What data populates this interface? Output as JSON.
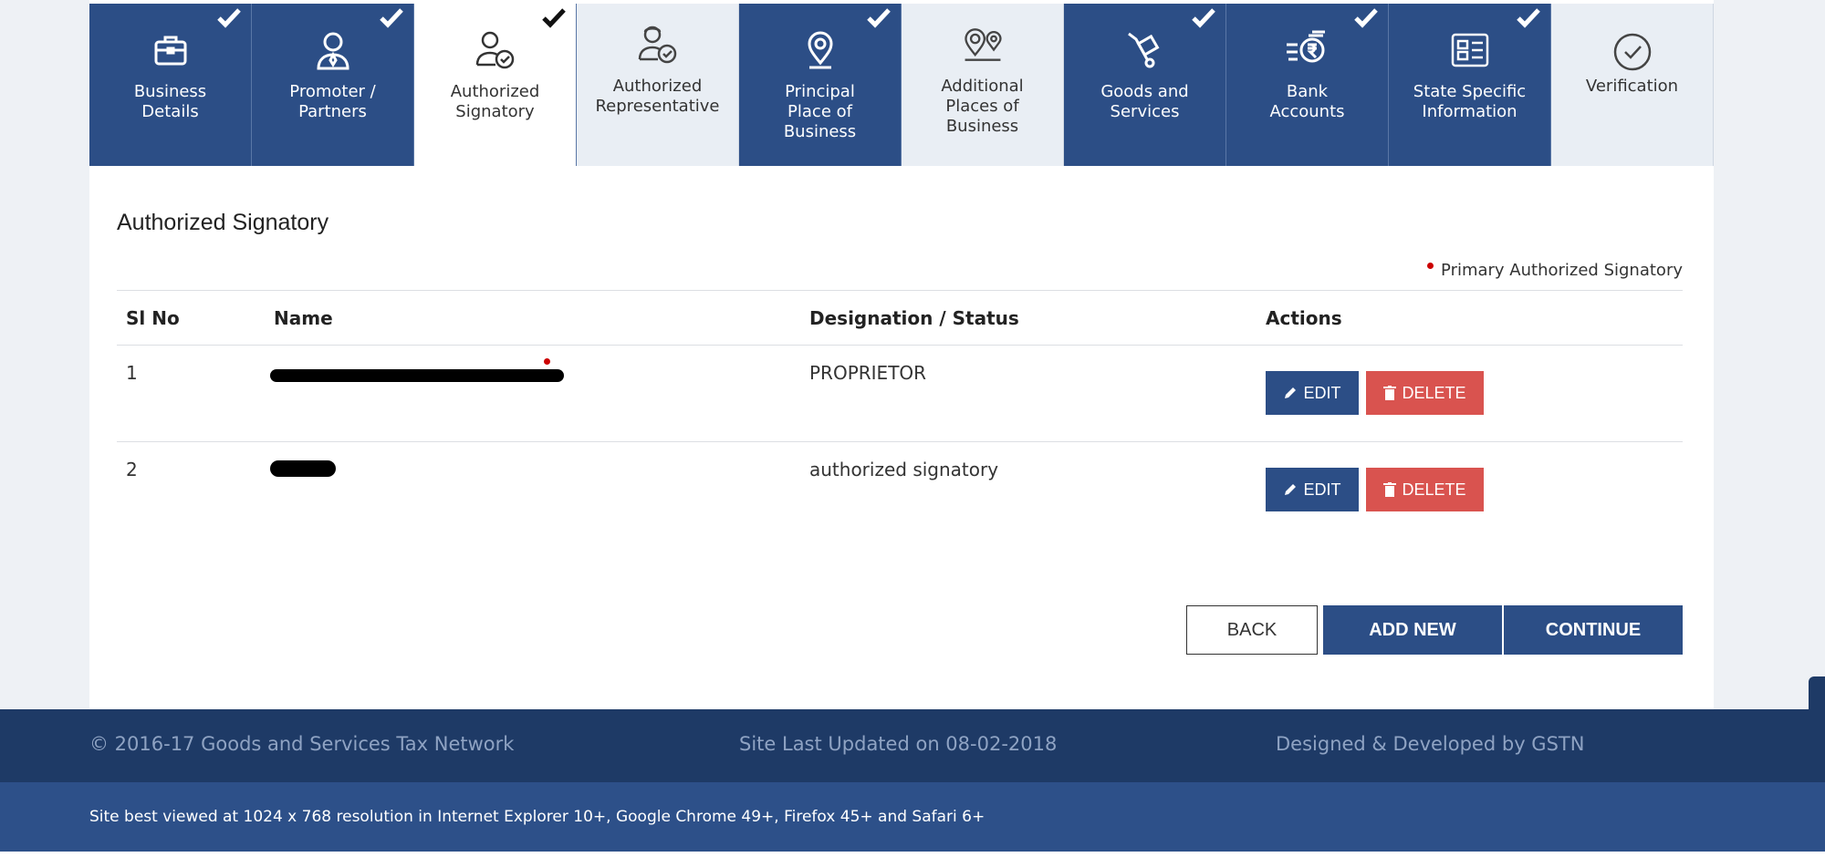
{
  "tabs": [
    {
      "label": "Business\nDetails",
      "icon": "briefcase-icon",
      "completed": true,
      "style": "dark"
    },
    {
      "label": "Promoter /\nPartners",
      "icon": "person-tie-icon",
      "completed": true,
      "style": "dark"
    },
    {
      "label": "Authorized\nSignatory",
      "icon": "person-check-icon",
      "completed": true,
      "style": "active"
    },
    {
      "label": "Authorized\nRepresentative",
      "icon": "person-headset-check-icon",
      "completed": false,
      "style": "light"
    },
    {
      "label": "Principal\nPlace of\nBusiness",
      "icon": "location-pin-icon",
      "completed": true,
      "style": "dark"
    },
    {
      "label": "Additional\nPlaces of\nBusiness",
      "icon": "two-location-pins-icon",
      "completed": false,
      "style": "light"
    },
    {
      "label": "Goods and\nServices",
      "icon": "hand-truck-icon",
      "completed": true,
      "style": "dark"
    },
    {
      "label": "Bank\nAccounts",
      "icon": "rupee-coin-icon",
      "completed": true,
      "style": "dark"
    },
    {
      "label": "State Specific\nInformation",
      "icon": "id-card-icon",
      "completed": true,
      "style": "dark"
    },
    {
      "label": "Verification",
      "icon": "circle-check-icon",
      "completed": false,
      "style": "light"
    }
  ],
  "page": {
    "section_title": "Authorized Signatory",
    "legend": "Primary Authorized Signatory"
  },
  "table": {
    "headers": {
      "sl_no": "Sl No",
      "name": "Name",
      "designation": "Designation / Status",
      "actions": "Actions"
    },
    "rows": [
      {
        "sl_no": "1",
        "designation": "PROPRIETOR",
        "primary": true
      },
      {
        "sl_no": "2",
        "designation": "authorized signatory",
        "primary": false
      }
    ],
    "edit_label": "EDIT",
    "delete_label": "DELETE"
  },
  "buttons": {
    "back": "BACK",
    "add_new": "ADD NEW",
    "continue": "CONTINUE"
  },
  "footer": {
    "copyright": "© 2016-17 Goods and Services Tax Network",
    "updated": "Site Last Updated on 08-02-2018",
    "developed": "Designed & Developed by GSTN",
    "best_viewed": "Site best viewed at 1024 x 768 resolution in Internet Explorer 10+, Google Chrome 49+, Firefox 45+ and Safari 6+"
  },
  "colors": {
    "primary": "#2c4e86",
    "danger": "#d9534f",
    "footer_dark": "#1e3a66",
    "footer_light": "#2d5089"
  }
}
